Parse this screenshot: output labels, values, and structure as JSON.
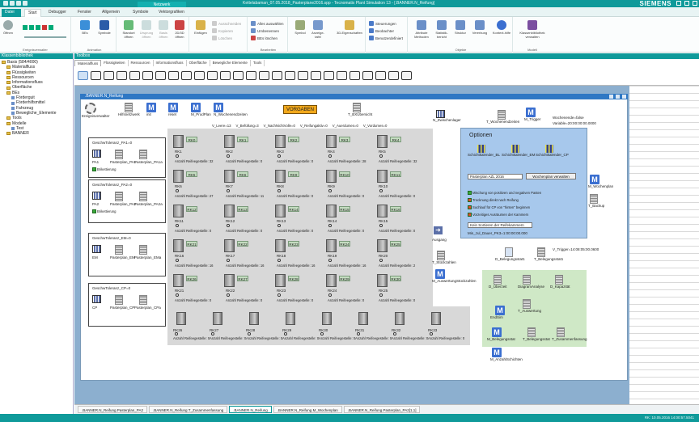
{
  "window": {
    "title": "Kettelabaman_07.05.2018_Pasterplane2016.spp - Tecnomatix Plant Simulation 13 - [.BANNER.N_Reifung]",
    "brand": "SIEMENS",
    "context_tab": "Netzwerk"
  },
  "ribbon_tabs": [
    "Datei",
    "Start",
    "Debugger",
    "Fenster",
    "Allgemein",
    "Symbole",
    "Vektorgrafiken"
  ],
  "search_placeholder": "Einen Befehl suchen",
  "ribbon": {
    "groups": [
      "Ereignisverwalter",
      "Animation",
      "Bearbeiten",
      "Objekte",
      "Modell"
    ],
    "buttons": {
      "oeffnen": "Öffnen",
      "beis": "BEs",
      "symbole": "Symbole",
      "standort": "Standort öffnen",
      "ursprung": "Ursprung öffnen",
      "basis": "Basis öffnen",
      "d2d3d": "2D/3D öffnen",
      "einfuegen": "Einfügen",
      "ausschneiden": "Ausschneiden",
      "kopieren": "Kopieren",
      "loeschen": "Löschen",
      "alles_auswaehlen": "Alles auswählen",
      "umbenennen": "Umbenennen",
      "bes_loeschen": "BEs löschen",
      "symbol_anzeige": "Symbol-Anzeigetafel",
      "eigenschaften": "3D-Eigenschaften",
      "steuerungen": "Steuerungen",
      "beobachter": "Beobachter",
      "benutzerdefiniert": "Benutzerdefiniert",
      "attribute": "Attribute Methoden",
      "statistik": "Statistik-bericht",
      "struktur": "Struktur",
      "vererbung": "Vererbung",
      "kontexthilfe": "Kontext-hilfe",
      "klassenbibliothek": "Klassenbibliothek verwalten"
    }
  },
  "left_panel": {
    "title": "Klassenbibliothek",
    "tree": [
      {
        "label": "Basis (584/4000)",
        "level": 0
      },
      {
        "label": "Materialfluss",
        "level": 1
      },
      {
        "label": "Flüssigkeiten",
        "level": 1
      },
      {
        "label": "Ressourcen",
        "level": 1
      },
      {
        "label": "Informationsfluss",
        "level": 1
      },
      {
        "label": "Oberfläche",
        "level": 1
      },
      {
        "label": "BEs",
        "level": 1
      },
      {
        "label": "Förderguit",
        "level": 2
      },
      {
        "label": "Förderhilfsmittel",
        "level": 2
      },
      {
        "label": "Fahrzeug",
        "level": 2
      },
      {
        "label": "Bewegliche_Elemente",
        "level": 2
      },
      {
        "label": "Tools",
        "level": 1
      },
      {
        "label": "Modelle",
        "level": 1
      },
      {
        "label": "Test",
        "level": 2
      },
      {
        "label": "BANNER",
        "level": 1
      }
    ]
  },
  "toolbox": {
    "title": "Toolbox",
    "tabs": [
      "Materialfluss",
      "Flüssigkeiten",
      "Ressourcen",
      "Informationsfluss",
      "Oberfläche",
      "Bewegliche Elemente",
      "Tools"
    ]
  },
  "frame": {
    "title": ".BANNER.N_Reifung",
    "top_icons": [
      "Ereignisverwalter",
      "Hilfsnetzwerk",
      "init",
      "reset",
      "M_ProdPlan",
      "N_Wochenendzeiten"
    ],
    "vorgaben": "VORGABEN",
    "t_bxuebersicht": "T_BXÜbersicht",
    "variables": [
      "V_Leere=13",
      "V_Befüllung=3",
      "V_NachNichtVolle=0",
      "V_Reifungaktiv=0",
      "V_Auerdumes=0",
      "V_Vordumes=0"
    ],
    "n_zwischenlager": "N_Zwischenlager",
    "t_wochenend": "T_Wochenendzeiten",
    "m_trigger": "M_Trigger",
    "wochenende": "Wochenende=false",
    "variable_line": "Variable=20:00:00:00.0000",
    "left_boxes": [
      {
        "title": "GeschwToleranz_PA1=0",
        "src": "PA1",
        "items": [
          "Pasterplan_PA1",
          "Pasterplan_PA1a"
        ],
        "check": "Brikettierung"
      },
      {
        "title": "GeschwToleranz_PA2=0",
        "src": "PA2",
        "items": [
          "Pasterplan_PA2",
          "Pasterplan_PA2a"
        ],
        "check": "Brikettierung"
      },
      {
        "title": "GeschwToleranz_EM=0",
        "src": "EM",
        "items": [
          "Pasterplan_EM",
          "Pasterplan_EMa"
        ],
        "check": ""
      },
      {
        "title": "GeschwToleranz_CP=0",
        "src": "CP",
        "items": [
          "Pasterplan_CP",
          "Pasterplan_CPa"
        ],
        "check": ""
      }
    ],
    "racks": [
      {
        "name": "RK1",
        "tag": "RK0",
        "info": "Anzahl Reifeegestelle: 32"
      },
      {
        "name": "RK2",
        "tag": "RK1",
        "info": "Anzahl Reifeegestelle: 0"
      },
      {
        "name": "RK3",
        "tag": "RK2",
        "info": "Anzahl Reifeegestelle: 0"
      },
      {
        "name": "RK4",
        "tag": "RK3",
        "info": "Anzahl Reifeegestelle: 28"
      },
      {
        "name": "RK5",
        "tag": "RK4",
        "info": "Anzahl Reifeegestelle: 32"
      },
      {
        "name": "RK6",
        "tag": "RK5",
        "info": "Anzahl Reifeegestelle: 27"
      },
      {
        "name": "RK7",
        "tag": "RK6",
        "info": "Anzahl Reifeegestelle: 11"
      },
      {
        "name": "RK8",
        "tag": "RK9",
        "info": "Anzahl Reifeegestelle: 0"
      },
      {
        "name": "RK9",
        "tag": "RK10",
        "info": "Anzahl Reifeegestelle: 0"
      },
      {
        "name": "RK10",
        "tag": "RK11",
        "info": "Anzahl Reifeegestelle: 0"
      },
      {
        "name": "RK11",
        "tag": "RK12",
        "info": "Anzahl Reifeegestelle: 0"
      },
      {
        "name": "RK12",
        "tag": "RK13",
        "info": "Anzahl Reifeegestelle: 0"
      },
      {
        "name": "RK13",
        "tag": "RK14",
        "info": "Anzahl Reifeegestelle: 0"
      },
      {
        "name": "RK14",
        "tag": "RK15",
        "info": "Anzahl Reifeegestelle: 0"
      },
      {
        "name": "RK15",
        "tag": "RK16",
        "info": "Anzahl Reifeegestelle: 0"
      },
      {
        "name": "RK16",
        "tag": "RK21",
        "info": "Anzahl Reifeegestelle: 16"
      },
      {
        "name": "RK17",
        "tag": "RK22",
        "info": "Anzahl Reifeegestelle: 16"
      },
      {
        "name": "RK18",
        "tag": "RK23",
        "info": "Anzahl Reifeegestelle: 16"
      },
      {
        "name": "RK19",
        "tag": "RK24",
        "info": "Anzahl Reifeegestelle: 16"
      },
      {
        "name": "RK20",
        "tag": "RK25",
        "info": "Anzahl Reifeegestelle: 2"
      },
      {
        "name": "RK21",
        "tag": "RK26",
        "info": "Anzahl Reifeegestelle: 0"
      },
      {
        "name": "RK22",
        "tag": "RK27",
        "info": "Anzahl Reifeegestelle: 0"
      },
      {
        "name": "RK23",
        "tag": "RK28",
        "info": "Anzahl Reifeegestelle: 0"
      },
      {
        "name": "RK24",
        "tag": "RK29",
        "info": "Anzahl Reifeegestelle: 0"
      },
      {
        "name": "RK25",
        "tag": "RK30",
        "info": "Anzahl Reifeegestelle: 0"
      }
    ],
    "bottom_racks": [
      {
        "name": "RK26",
        "info": "Anzahl Reifeegestelle: 0"
      },
      {
        "name": "RK27",
        "info": "Anzahl Reifeegestelle: 0"
      },
      {
        "name": "RK28",
        "info": "Anzahl Reifeegestelle: 0"
      },
      {
        "name": "RK29",
        "info": "Anzahl Reifeegestelle: 0"
      },
      {
        "name": "RK30",
        "info": "Anzahl Reifeegestelle: 0"
      },
      {
        "name": "RK31",
        "info": "Anzahl Reifeegestelle: 0"
      },
      {
        "name": "RK32",
        "info": "Anzahl Reifeegestelle: 0"
      },
      {
        "name": "RK33",
        "info": "Anzahl Reifeegestelle: 0"
      }
    ],
    "ausgang": "Ausgang",
    "t_stueckzahlen": "T_Stückzahlen",
    "m_auswertung": "M_AuswertungStückzahlen",
    "options": {
      "title": "Optionen",
      "items": [
        "Schichtkalender_BL",
        "Schichtkalender_EM",
        "Schichtkalender_CP"
      ],
      "dropdown": "Pasterplan AZL 2016",
      "button": "Wochenplan verwalten",
      "checks": [
        "Mischung von positiven und negativen Pasten",
        "Trocknung direkt nach Reifung",
        "Suchlauf für CP von \"hinten\" beginnen",
        "Vorzeitiges Ausräumen der Kammern"
      ],
      "dropdown2": "Kein Sortieren der Reifekammern",
      "min_line": "Min_zul_Dauer_PK3=1:00:00:00.000"
    },
    "m_wochenplan": "M_Wochenplan",
    "t_backup": "T_Backup",
    "v_trigger": "V_Trigger=14:08:05:00.0600",
    "d_belegungsstat1": "D_Belegungsstat1",
    "t_belegungsstat1": "T_Belegungsstat1",
    "green": [
      "D_Überzeit",
      "DiagramAnalyse",
      "D_Kapazität",
      "T_Auswertung",
      "EndSim",
      "M_Belegungsstat",
      "T_Belegungsstat",
      "T_Zusammenfassung"
    ],
    "m_anzahlschichten": "M_AnzahlSchichten"
  },
  "doc_tabs": [
    ".BANNER.N_Reifung.Pasterplan_PA2",
    ".BANNER.N_Reifung.T_Zusammenfassung",
    ".BANNER.N_Reifung",
    ".BANNER.N_Reifung.M_Wochenplan",
    ".BANNER.N_Reifung.Pasterplan_PA2[1,1]"
  ],
  "status": {
    "left": "",
    "right": "RK: 10.05.2016 14:00:57.5041"
  },
  "colors": {
    "teal": "#0f9a9a",
    "frame_blue": "#2f78c4",
    "vorgaben": "#f2a81a",
    "options_bg": "#a7c8ec",
    "green_bg": "#cfe8c6"
  }
}
